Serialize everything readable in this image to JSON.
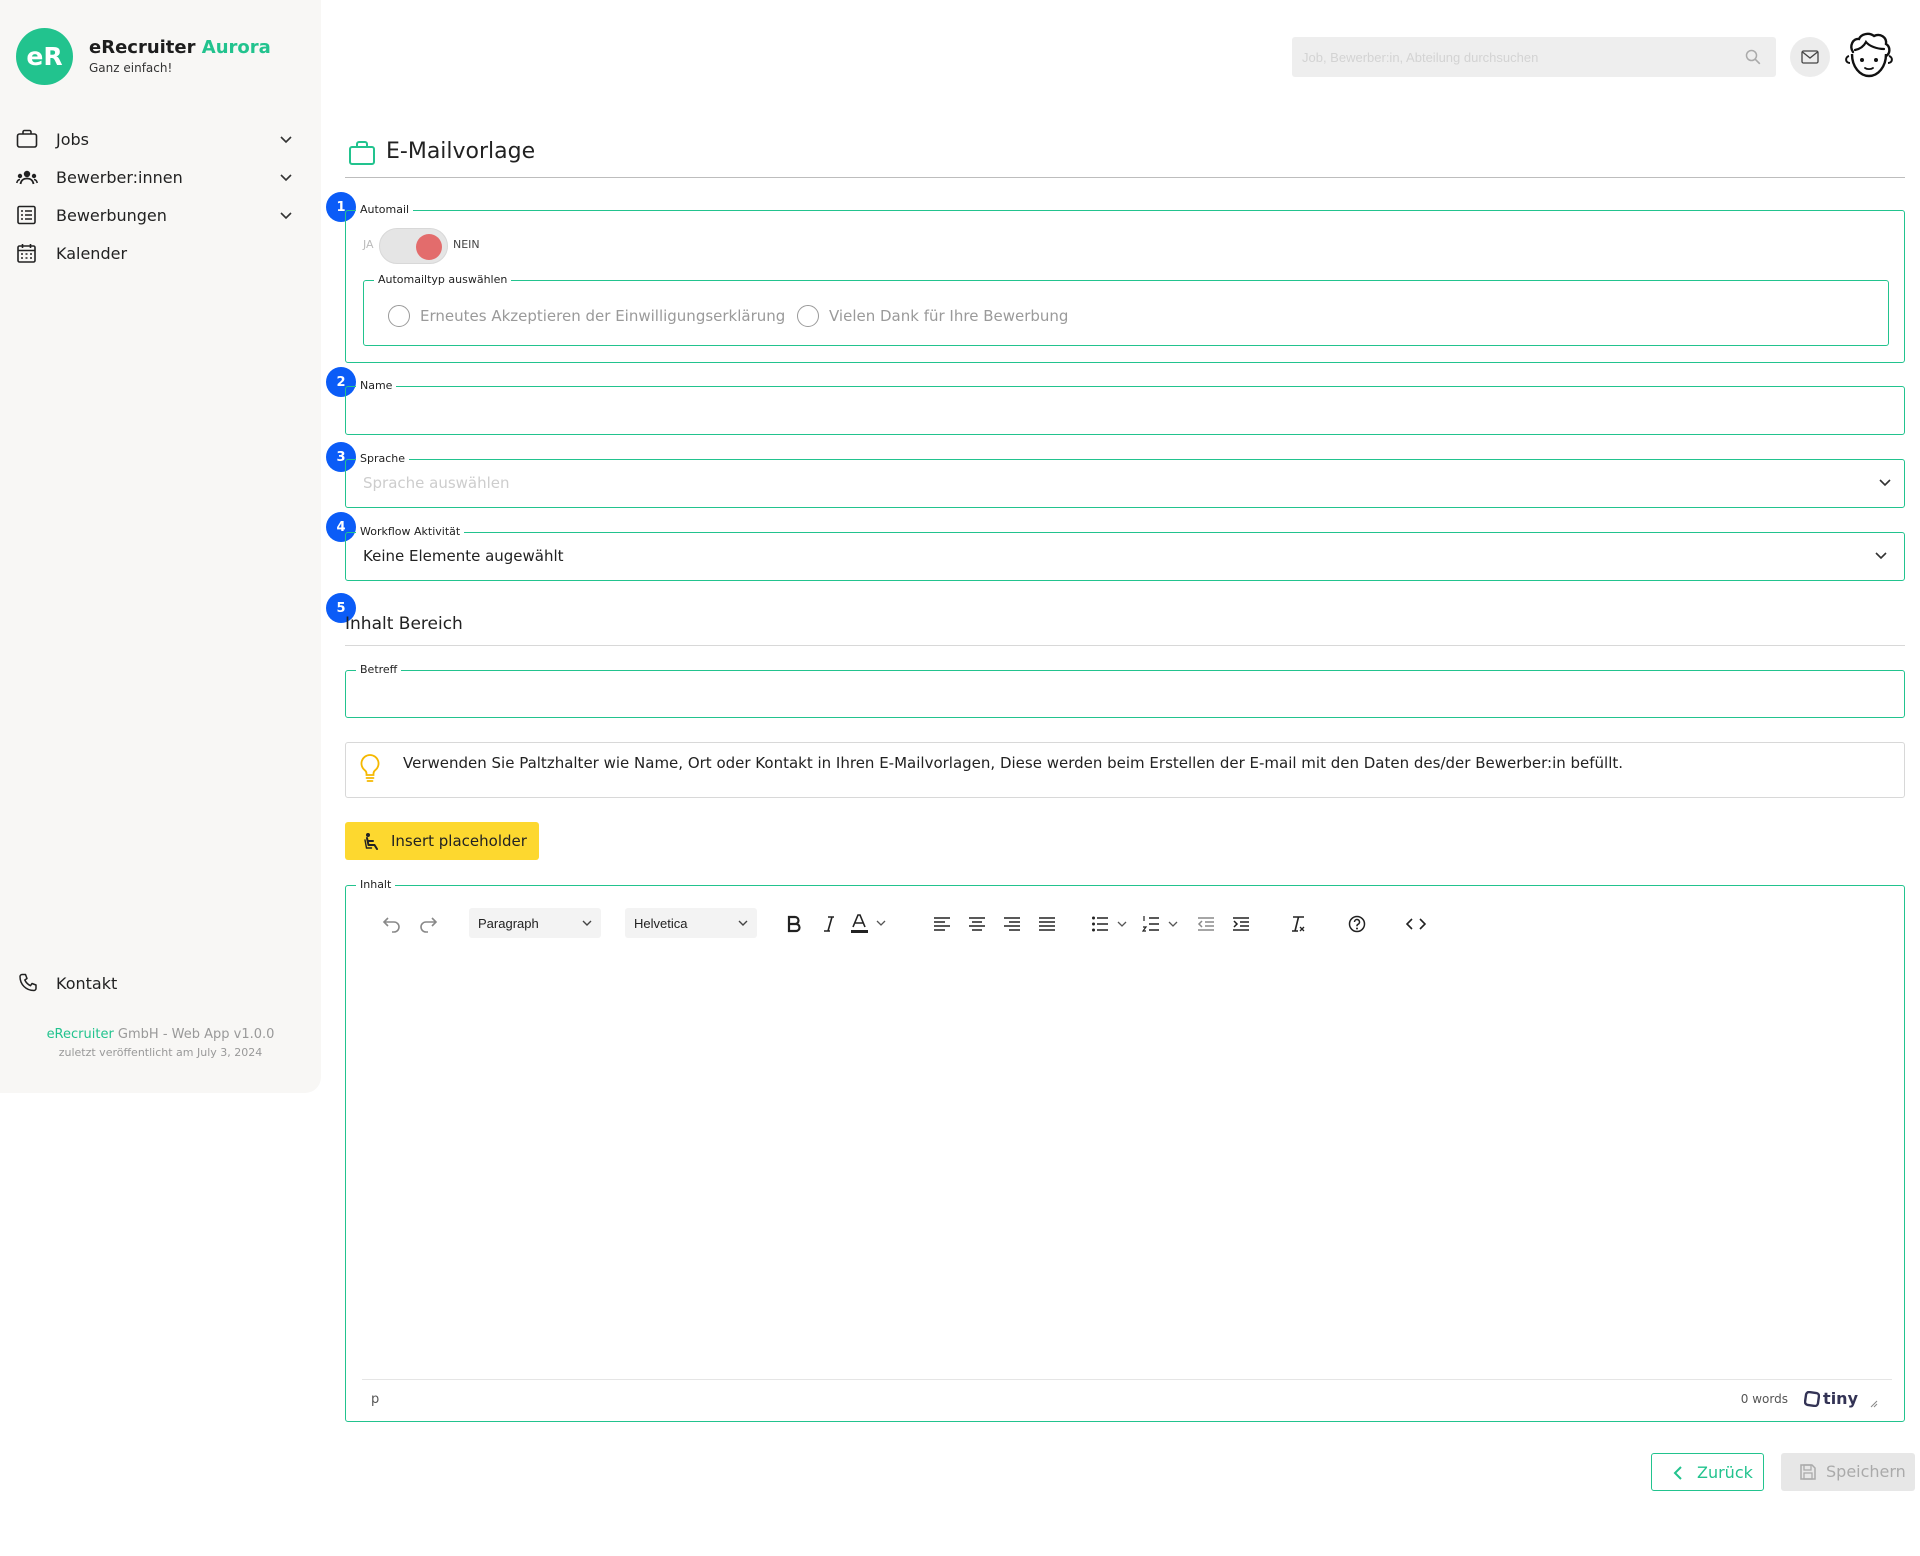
{
  "colors": {
    "accent": "#22c38e",
    "step_badge": "#0b5cf7",
    "toggle_knob": "#e36c6c",
    "insert_button": "#fdd82f"
  },
  "sidebar": {
    "logo_text": "eR",
    "brand_name": "eRecruiter",
    "brand_accent": "Aurora",
    "tagline": "Ganz einfach!",
    "items": [
      {
        "label": "Jobs",
        "icon": "briefcase-icon",
        "expandable": true
      },
      {
        "label": "Bewerber:innen",
        "icon": "people-icon",
        "expandable": true
      },
      {
        "label": "Bewerbungen",
        "icon": "list-icon",
        "expandable": true
      },
      {
        "label": "Kalender",
        "icon": "calendar-icon",
        "expandable": false
      }
    ],
    "contact_label": "Kontakt",
    "footer_company": "eRecruiter",
    "footer_rest": " GmbH - Web App v1.0.0",
    "footer_published": "zuletzt veröffentlicht am July 3, 2024"
  },
  "header": {
    "search_placeholder": "Job, Bewerber:in, Abteilung durchsuchen",
    "icons": [
      "search-icon",
      "mail-icon",
      "avatar"
    ]
  },
  "page": {
    "title": "E-Mailvorlage",
    "title_icon": "briefcase-icon"
  },
  "form": {
    "automail": {
      "step": "1",
      "legend": "Automail",
      "toggle_yes": "JA",
      "toggle_no": "NEIN",
      "toggle_value": "NEIN",
      "type_legend": "Automailtyp auswählen",
      "options": [
        "Erneutes Akzeptieren der Einwilligungserklärung",
        "Vielen Dank für Ihre Bewerbung"
      ]
    },
    "name": {
      "step": "2",
      "legend": "Name",
      "value": ""
    },
    "language": {
      "step": "3",
      "legend": "Sprache",
      "placeholder": "Sprache auswählen"
    },
    "workflow": {
      "step": "4",
      "legend": "Workflow Aktivität",
      "value": "Keine Elemente augewählt"
    }
  },
  "content": {
    "step": "5",
    "section_title_bold": "Inhalt",
    "section_title_rest": " Bereich",
    "subject_legend": "Betreff",
    "subject_value": "",
    "info_text": "Verwenden Sie Paltzhalter wie Name, Ort oder Kontakt in Ihren E-Mailvorlagen, Diese werden beim Erstellen der E-mail mit den Daten des/der Bewerber:in befüllt.",
    "insert_button": "Insert placeholder",
    "editor_legend": "Inhalt",
    "editor": {
      "block_format": "Paragraph",
      "font_family": "Helvetica",
      "toolbar_icons": [
        "undo-icon",
        "redo-icon",
        "bold-icon",
        "italic-icon",
        "text-color-icon",
        "align-left-icon",
        "align-center-icon",
        "align-right-icon",
        "align-justify-icon",
        "bullet-list-icon",
        "numbered-list-icon",
        "outdent-icon",
        "indent-icon",
        "clear-format-icon",
        "help-icon",
        "source-code-icon"
      ],
      "status_path": "p",
      "word_count": "0 words",
      "brand": "tiny"
    }
  },
  "actions": {
    "back": "Zurück",
    "save": "Speichern"
  }
}
